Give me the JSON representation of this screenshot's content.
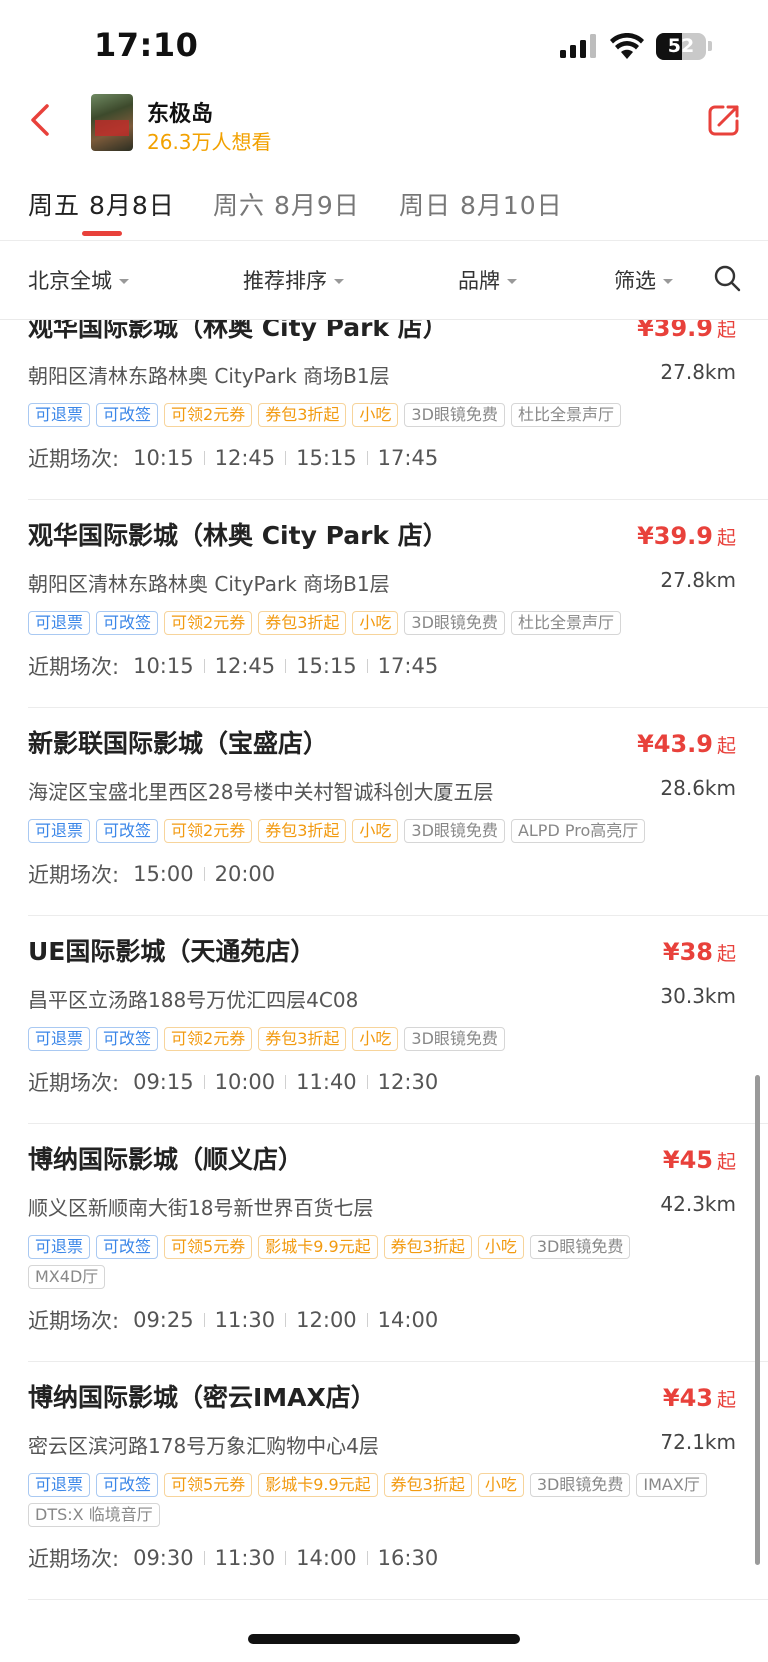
{
  "status_bar": {
    "time": "17:10",
    "battery": "52",
    "battery_level": 0.52
  },
  "header": {
    "movie_title": "东极岛",
    "want_count": "26.3万人想看",
    "icons": {
      "back": "back-arrow-icon",
      "share": "share-icon"
    }
  },
  "date_tabs": [
    {
      "label": "周五 8月8日",
      "active": true
    },
    {
      "label": "周六 8月9日",
      "active": false
    },
    {
      "label": "周日 8月10日",
      "active": false
    }
  ],
  "filters": {
    "city": "北京全城",
    "sort": "推荐排序",
    "brand": "品牌",
    "filter": "筛选",
    "search_icon": "search-icon"
  },
  "colors": {
    "accent": "#e8413b",
    "want": "#f2a100",
    "tag_blue": "#3a86e8",
    "tag_orange": "#f29a10"
  },
  "cinemas": [
    {
      "name": "观华国际影城（林奥 City Park 店）",
      "price": "¥39.9",
      "price_suffix": "起",
      "address": "朝阳区清林东路林奥 CityPark 商场B1层",
      "distance": "27.8km",
      "tags": [
        {
          "text": "可退票",
          "type": "blue"
        },
        {
          "text": "可改签",
          "type": "blue"
        },
        {
          "text": "可领2元券",
          "type": "orange"
        },
        {
          "text": "券包3折起",
          "type": "orange"
        },
        {
          "text": "小吃",
          "type": "orange"
        },
        {
          "text": "3D眼镜免费",
          "type": "gray"
        },
        {
          "text": "杜比全景声厅",
          "type": "gray"
        }
      ],
      "times_label": "近期场次:",
      "times": [
        "10:15",
        "12:45",
        "15:15",
        "17:45"
      ]
    },
    {
      "name": "观华国际影城（林奥 City Park 店）",
      "price": "¥39.9",
      "price_suffix": "起",
      "address": "朝阳区清林东路林奥 CityPark 商场B1层",
      "distance": "27.8km",
      "tags": [
        {
          "text": "可退票",
          "type": "blue"
        },
        {
          "text": "可改签",
          "type": "blue"
        },
        {
          "text": "可领2元券",
          "type": "orange"
        },
        {
          "text": "券包3折起",
          "type": "orange"
        },
        {
          "text": "小吃",
          "type": "orange"
        },
        {
          "text": "3D眼镜免费",
          "type": "gray"
        },
        {
          "text": "杜比全景声厅",
          "type": "gray"
        }
      ],
      "times_label": "近期场次:",
      "times": [
        "10:15",
        "12:45",
        "15:15",
        "17:45"
      ]
    },
    {
      "name": "新影联国际影城（宝盛店）",
      "price": "¥43.9",
      "price_suffix": "起",
      "address": "海淀区宝盛北里西区28号楼中关村智诚科创大厦五层",
      "distance": "28.6km",
      "tags": [
        {
          "text": "可退票",
          "type": "blue"
        },
        {
          "text": "可改签",
          "type": "blue"
        },
        {
          "text": "可领2元券",
          "type": "orange"
        },
        {
          "text": "券包3折起",
          "type": "orange"
        },
        {
          "text": "小吃",
          "type": "orange"
        },
        {
          "text": "3D眼镜免费",
          "type": "gray"
        },
        {
          "text": "ALPD Pro高亮厅",
          "type": "gray"
        }
      ],
      "times_label": "近期场次:",
      "times": [
        "15:00",
        "20:00"
      ]
    },
    {
      "name": "UE国际影城（天通苑店）",
      "price": "¥38",
      "price_suffix": "起",
      "address": "昌平区立汤路188号万优汇四层4C08",
      "distance": "30.3km",
      "tags": [
        {
          "text": "可退票",
          "type": "blue"
        },
        {
          "text": "可改签",
          "type": "blue"
        },
        {
          "text": "可领2元券",
          "type": "orange"
        },
        {
          "text": "券包3折起",
          "type": "orange"
        },
        {
          "text": "小吃",
          "type": "orange"
        },
        {
          "text": "3D眼镜免费",
          "type": "gray"
        }
      ],
      "times_label": "近期场次:",
      "times": [
        "09:15",
        "10:00",
        "11:40",
        "12:30"
      ]
    },
    {
      "name": "博纳国际影城（顺义店）",
      "price": "¥45",
      "price_suffix": "起",
      "address": "顺义区新顺南大街18号新世界百货七层",
      "distance": "42.3km",
      "tags": [
        {
          "text": "可退票",
          "type": "blue"
        },
        {
          "text": "可改签",
          "type": "blue"
        },
        {
          "text": "可领5元券",
          "type": "orange"
        },
        {
          "text": "影城卡9.9元起",
          "type": "orange"
        },
        {
          "text": "券包3折起",
          "type": "orange"
        },
        {
          "text": "小吃",
          "type": "orange"
        },
        {
          "text": "3D眼镜免费",
          "type": "gray"
        },
        {
          "text": "MX4D厅",
          "type": "gray"
        }
      ],
      "times_label": "近期场次:",
      "times": [
        "09:25",
        "11:30",
        "12:00",
        "14:00"
      ]
    },
    {
      "name": "博纳国际影城（密云IMAX店）",
      "price": "¥43",
      "price_suffix": "起",
      "address": "密云区滨河路178号万象汇购物中心4层",
      "distance": "72.1km",
      "tags": [
        {
          "text": "可退票",
          "type": "blue"
        },
        {
          "text": "可改签",
          "type": "blue"
        },
        {
          "text": "可领5元券",
          "type": "orange"
        },
        {
          "text": "影城卡9.9元起",
          "type": "orange"
        },
        {
          "text": "券包3折起",
          "type": "orange"
        },
        {
          "text": "小吃",
          "type": "orange"
        },
        {
          "text": "3D眼镜免费",
          "type": "gray"
        },
        {
          "text": "IMAX厅",
          "type": "gray"
        },
        {
          "text": "DTS:X 临境音厅",
          "type": "gray"
        }
      ],
      "times_label": "近期场次:",
      "times": [
        "09:30",
        "11:30",
        "14:00",
        "16:30"
      ]
    }
  ]
}
